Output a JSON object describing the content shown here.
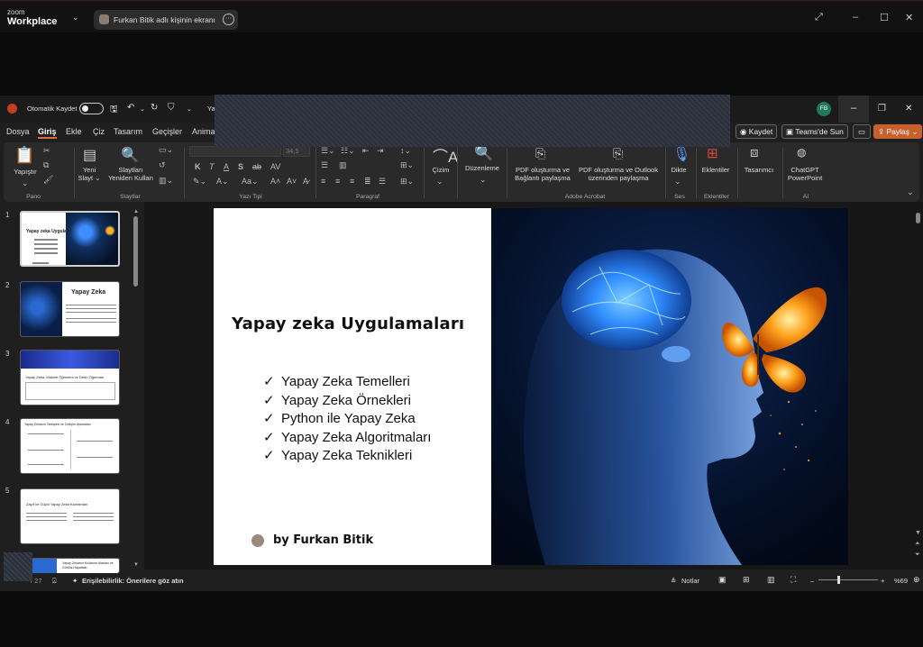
{
  "zoom": {
    "logo_line1": "zoom",
    "logo_line2": "Workplace",
    "share_label": "Furkan Bitik adlı kişinin ekranı"
  },
  "qat": {
    "autosave_label": "Otomatik Kaydet",
    "title_fragment": "Ya",
    "user_initials": "FB"
  },
  "tabs": [
    "Dosya",
    "Giriş",
    "Ekle",
    "Çiz",
    "Tasarım",
    "Geçişler",
    "Anima"
  ],
  "active_tab": "Giriş",
  "right_buttons": {
    "save": "Kaydet",
    "teams": "Teams'de Sun",
    "share": "Paylaş"
  },
  "ribbon": {
    "paste": "Yapıştır",
    "new_slide_l1": "Yeni",
    "new_slide_l2": "Slayt",
    "reuse_l1": "Slaytları",
    "reuse_l2": "Yeniden Kullan",
    "font_size": "34,5",
    "draw": "Çizim",
    "edit": "Düzenleme",
    "pdf1_l1": "PDF oluşturma ve",
    "pdf1_l2": "Bağlantı paylaşma",
    "pdf2_l1": "PDF oluşturma ve Outlook",
    "pdf2_l2": "üzerinden paylaşma",
    "dictate": "Dikte",
    "addins": "Eklentiler",
    "designer": "Tasarımcı",
    "chatgpt_l1": "ChatGPT",
    "chatgpt_l2": "PowerPoint",
    "groups": {
      "clipboard": "Pano",
      "slides": "Slaytlar",
      "font": "Yazı Tipi",
      "paragraph": "Paragraf",
      "acrobat": "Adobe Acrobat",
      "voice": "Ses",
      "addins": "Eklentiler",
      "ai": "AI"
    },
    "font_buttons": [
      "K",
      "T",
      "A",
      "S",
      "ab",
      "AV",
      "Aa",
      "A",
      "A"
    ]
  },
  "thumbnails": [
    {
      "num": "1",
      "title": "Yapay zeka Uygulamaları"
    },
    {
      "num": "2",
      "title": "Yapay Zeka"
    },
    {
      "num": "3",
      "title": "Yapay Zeka, Makine Öğrenimi ve Derin Öğrenme"
    },
    {
      "num": "4",
      "title": "Yapay Zekanın Tarihçesi ve Gelişim Aşamaları"
    },
    {
      "num": "5",
      "title": "Zayıf ve Güçlü Yapay Zeka Kavramları"
    },
    {
      "num": "",
      "title": "Yapay Zekanın Kullanım Alanları ve Günlük Hayattaki"
    }
  ],
  "slide": {
    "title": "Yapay zeka Uygulamaları",
    "bullets": [
      "Yapay Zeka Temelleri",
      "Yapay Zeka Örnekleri",
      "Python ile Yapay Zeka",
      "Yapay Zeka Algoritmaları",
      "Yapay Zeka Teknikleri"
    ],
    "check_mark": "✓",
    "author": "by Furkan Bitik"
  },
  "status": {
    "slide_counter": "27",
    "accessibility": "Erişilebilirlik: Önerilere göz atın",
    "notes": "Notlar",
    "zoom_level": "%69"
  },
  "colors": {
    "accent_orange": "#c8602e",
    "brain_blue": "#2f8cff",
    "butterfly_orange": "#ffa21e"
  }
}
